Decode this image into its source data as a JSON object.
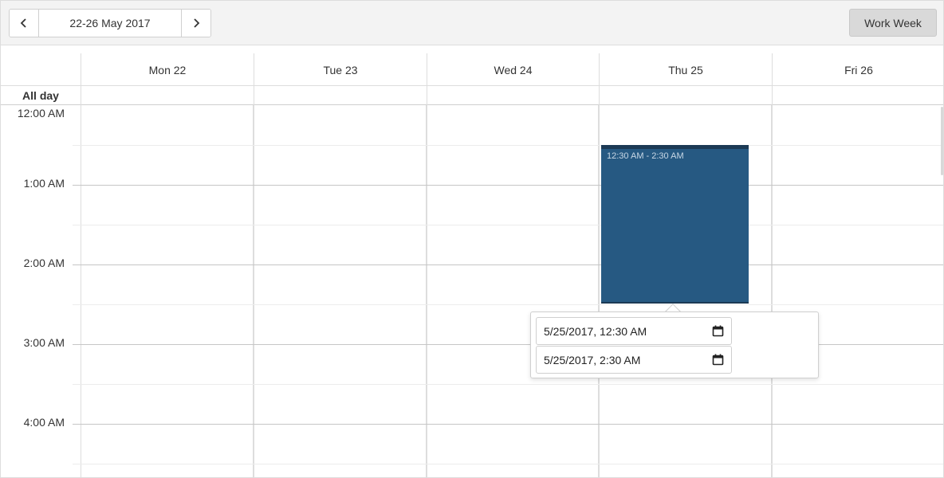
{
  "toolbar": {
    "prev_icon": "chevron-left-icon",
    "next_icon": "chevron-right-icon",
    "date_range": "22-26 May 2017",
    "view_label": "Work Week"
  },
  "days": [
    {
      "label": "Mon 22"
    },
    {
      "label": "Tue 23"
    },
    {
      "label": "Wed 24"
    },
    {
      "label": "Thu 25"
    },
    {
      "label": "Fri 26"
    }
  ],
  "all_day_label": "All day",
  "time_slots": [
    "12:00 AM",
    "1:00 AM",
    "2:00 AM",
    "3:00 AM",
    "4:00 AM"
  ],
  "event": {
    "time_text": "12:30 AM - 2:30 AM",
    "color": "#265982"
  },
  "popup": {
    "start": "5/25/2017, 12:30 AM",
    "end": "5/25/2017, 2:30 AM",
    "calendar_icon": "calendar-icon"
  }
}
